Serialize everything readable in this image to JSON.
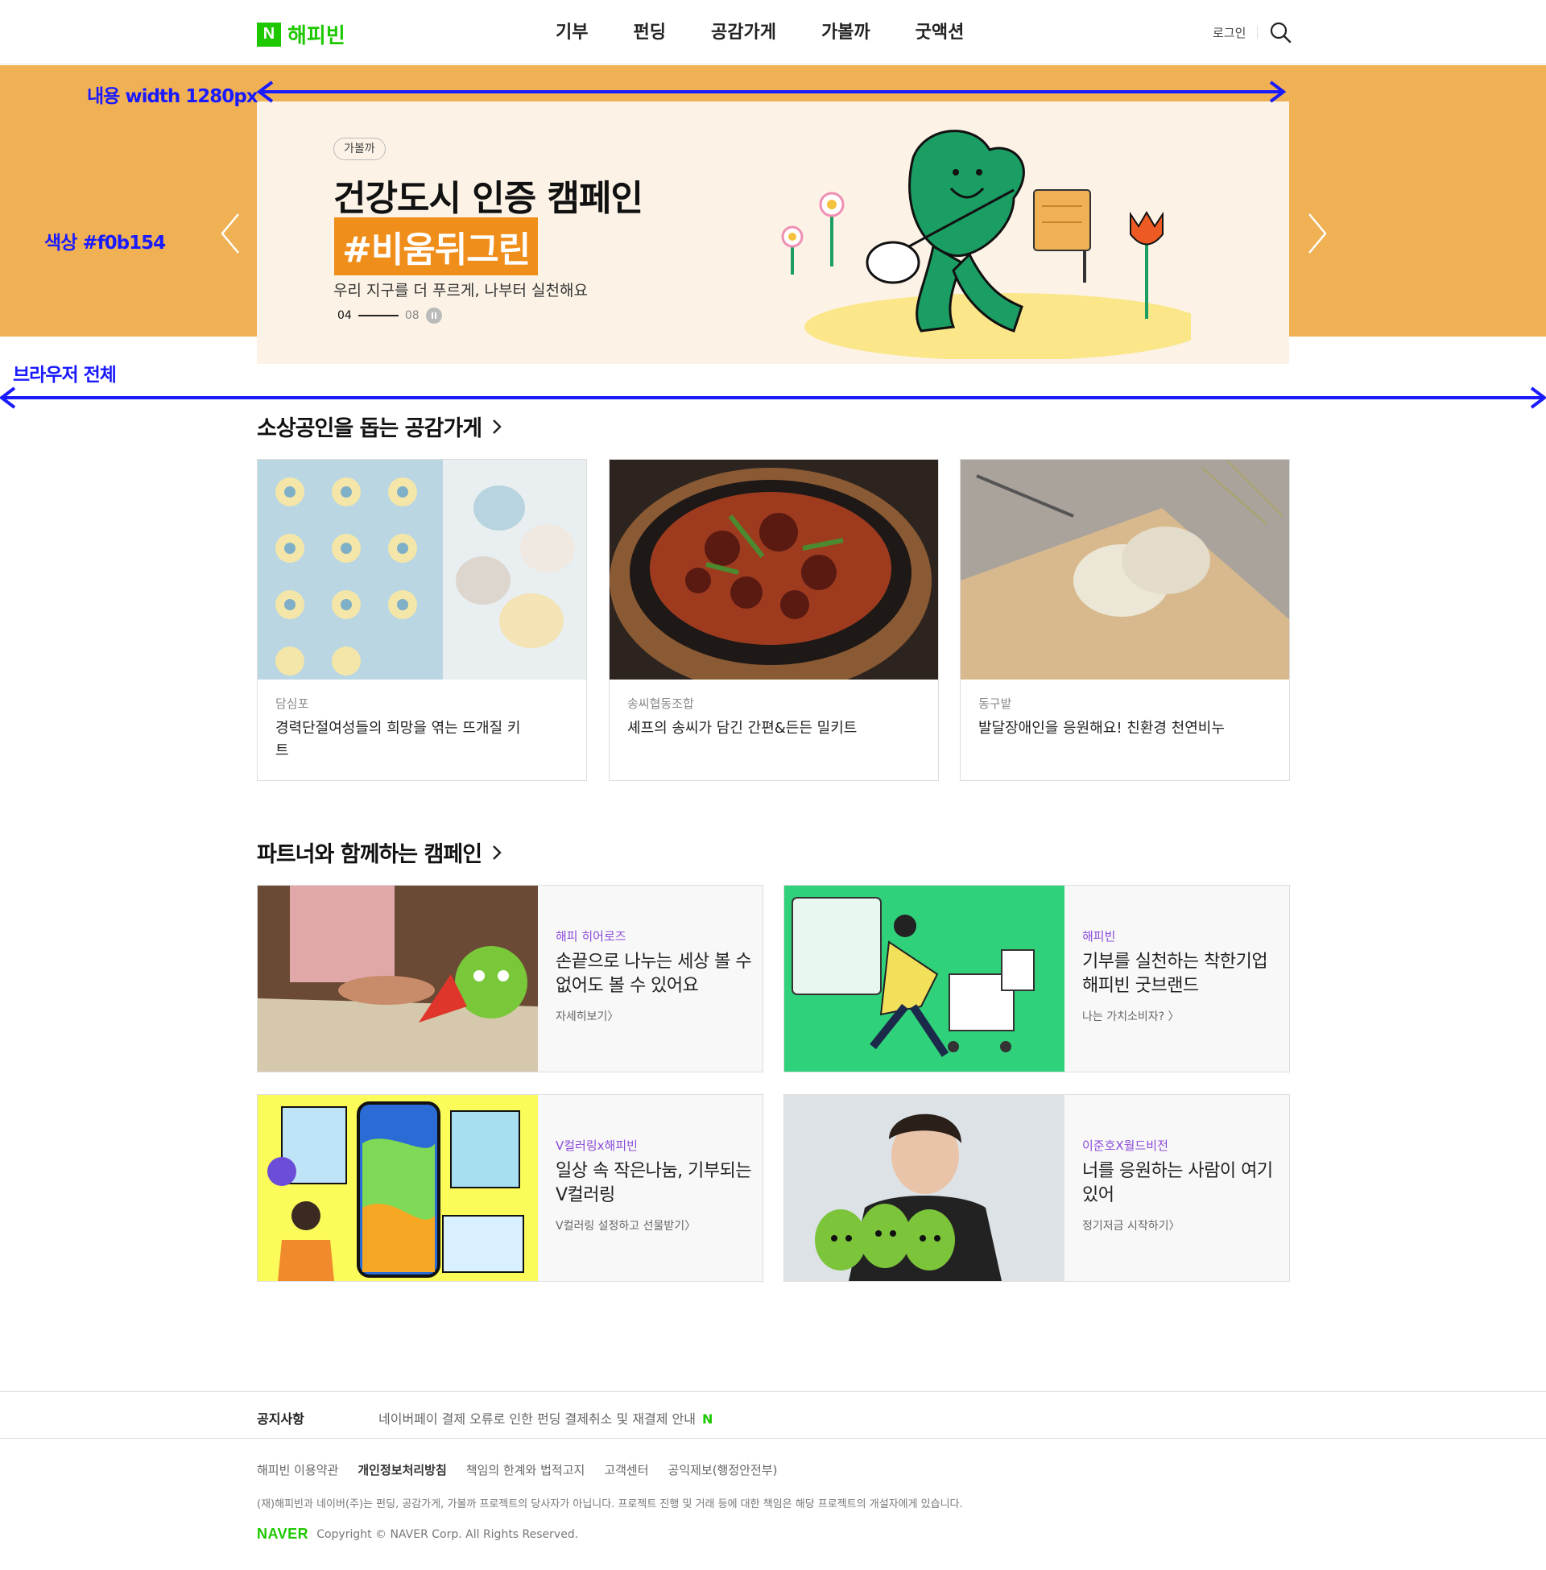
{
  "colors": {
    "brand": "#1ec800",
    "hero_bg": "#f0b154",
    "hero_card": "#fcf3e6",
    "highlight": "#f08e1c",
    "annotation": "#1a1aff",
    "category": "#8a4bd8"
  },
  "header": {
    "logo_mark": "N",
    "logo_text": "해피빈",
    "nav": [
      "기부",
      "펀딩",
      "공감가게",
      "가볼까",
      "굿액션"
    ],
    "login": "로그인",
    "search_icon": "search-icon"
  },
  "hero": {
    "tag": "가볼까",
    "title_line1": "건강도시 인증 캠페인",
    "title_line2": "#비움뒤그린",
    "subtitle": "우리 지구를 더 푸르게, 나부터 실천해요",
    "page_current": "04",
    "page_total": "08"
  },
  "annotations": {
    "content_width": "내용 width 1280px",
    "color": "색상 #f0b154",
    "browser_full": "브라우저 전체"
  },
  "store_section": {
    "title": "소상공인을 돕는 공감가게",
    "cards": [
      {
        "name": "담심포",
        "desc": "경력단절여성들의 희망을 엮는 뜨개질 키트"
      },
      {
        "name": "송씨협동조합",
        "desc": "셰프의 송씨가 담긴 간편&든든 밀키트"
      },
      {
        "name": "동구밭",
        "desc": "발달장애인을 응원해요! 친환경 천연비누"
      }
    ]
  },
  "partner_section": {
    "title": "파트너와 함께하는 캠페인",
    "cards": [
      {
        "category": "해피 히어로즈",
        "title": "손끝으로 나누는 세상 볼 수 없어도 볼 수 있어요",
        "link": "자세히보기〉"
      },
      {
        "category": "해피빈",
        "title": "기부를 실천하는 착한기업 해피빈 굿브랜드",
        "link": "나는 가치소비자? 〉"
      },
      {
        "category": "V컬러링x해피빈",
        "title": "일상 속 작은나눔, 기부되는 V컬러링",
        "link": "V컬러링 설정하고 선물받기〉"
      },
      {
        "category": "이준호X월드비전",
        "title": "너를 응원하는 사람이 여기 있어",
        "link": "정기저금 시작하기〉"
      }
    ]
  },
  "footer": {
    "notice_label": "공지사항",
    "notice_text": "네이버페이 결제 오류로 인한 펀딩 결제취소 및 재결제 안내",
    "notice_new": "N",
    "links": [
      "해피빈 이용약관",
      "개인정보처리방침",
      "책임의 한계와 법적고지",
      "고객센터",
      "공익제보(행정안전부)"
    ],
    "disclaimer": "(재)해피빈과 네이버(주)는 펀딩, 공감가게, 가볼까 프로젝트의 당사자가 아닙니다. 프로젝트 진행 및 거래 등에 대한 책임은 해당 프로젝트의 개설자에게 있습니다.",
    "naver_logo": "NAVER",
    "copyright": "Copyright © NAVER Corp. All Rights Reserved."
  }
}
